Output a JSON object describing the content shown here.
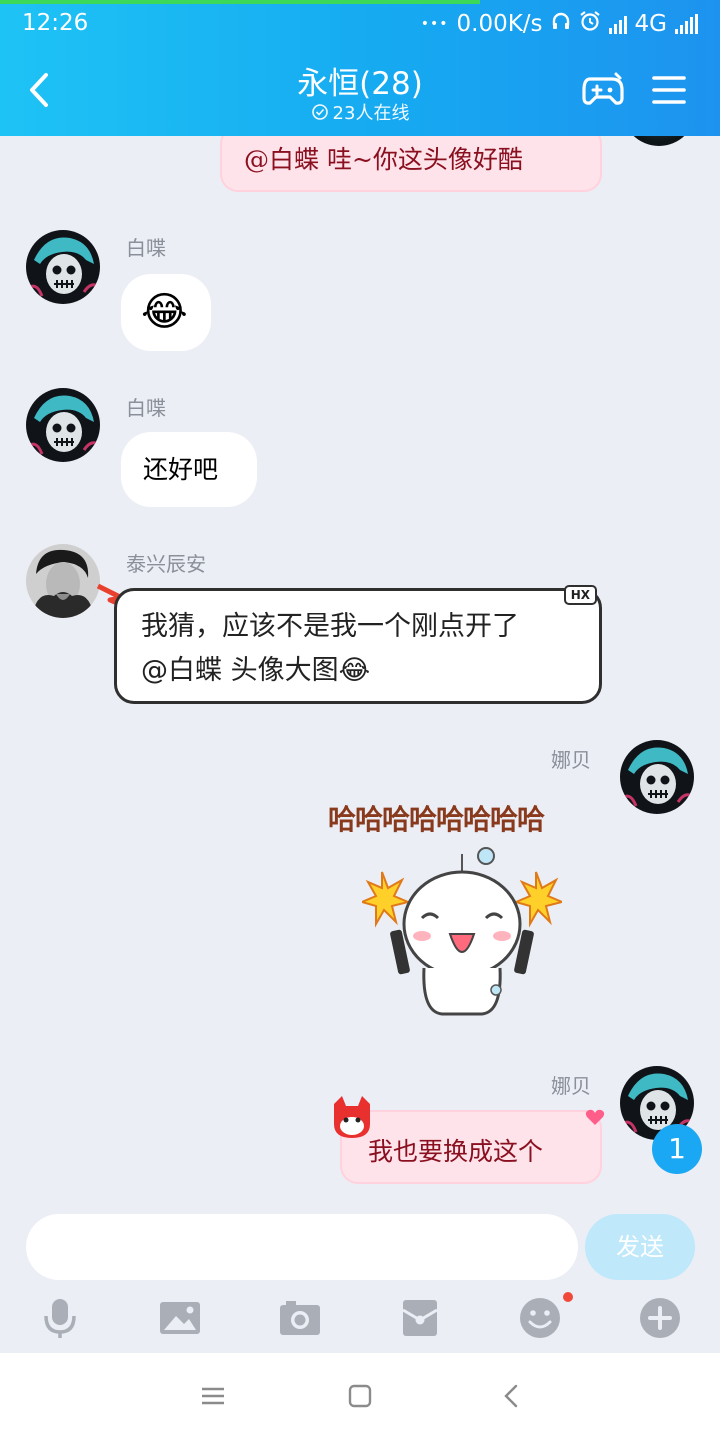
{
  "status_bar": {
    "time": "12:26",
    "dots": "•••",
    "speed": "0.00K/s",
    "network": "4G"
  },
  "header": {
    "title": "永恒(28)",
    "online": "23人在线"
  },
  "messages": {
    "top_partial_text": "@白蝶 哇~你这头像好酷",
    "m1": {
      "sender": "白喋",
      "emoji": "😂"
    },
    "m2": {
      "sender": "白喋",
      "text": "还好吧"
    },
    "m3": {
      "sender": "泰兴辰安",
      "line1": "我猜，应该不是我一个刚点开了",
      "line2": "@白蝶 头像大图😂",
      "tag": "HX"
    },
    "m4": {
      "sender": "娜贝",
      "sticker_text": "哈哈哈哈哈哈哈哈"
    },
    "m5": {
      "sender": "娜贝",
      "text": "我也要换成这个"
    }
  },
  "unread_count": "1",
  "composer": {
    "placeholder": "",
    "send_label": "发送"
  },
  "toolbar_icons": [
    "microphone-icon",
    "image-icon",
    "camera-icon",
    "red-packet-icon",
    "emoji-icon",
    "plus-icon"
  ],
  "colors": {
    "header_start": "#1ec3f5",
    "header_end": "#1d93ef",
    "chat_bg": "#ebeef5",
    "pink_bubble": "#ffe3ea",
    "send_disabled": "#bfe8fa",
    "unread_badge": "#1aa7f3"
  }
}
